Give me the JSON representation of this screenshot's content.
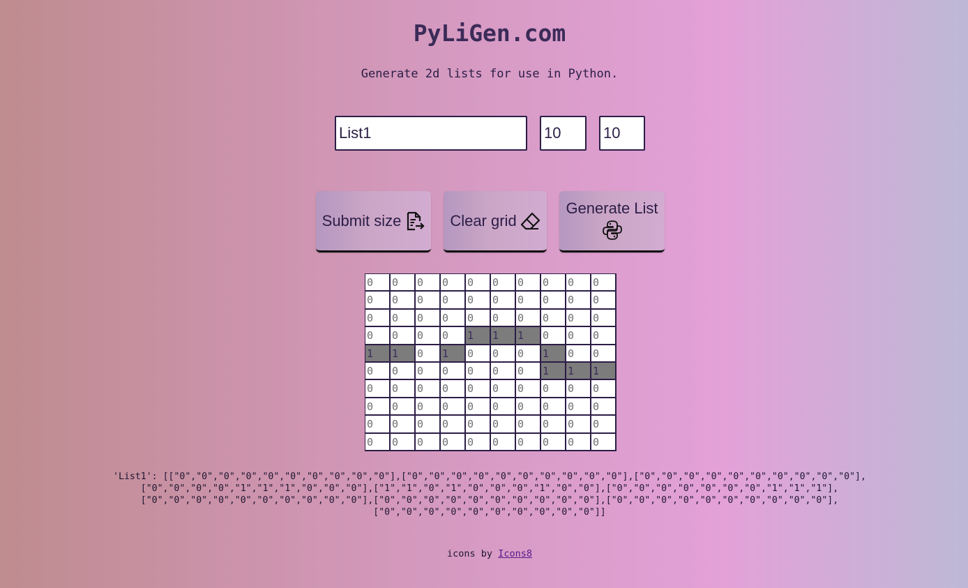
{
  "header": {
    "title": "PyLiGen.com",
    "subtitle": "Generate 2d lists for use in Python."
  },
  "form": {
    "list_name": "List1",
    "rows": "10",
    "cols": "10"
  },
  "buttons": {
    "submit_label": "Submit size",
    "clear_label": "Clear grid",
    "generate_label": "Generate List"
  },
  "grid": [
    [
      "0",
      "0",
      "0",
      "0",
      "0",
      "0",
      "0",
      "0",
      "0",
      "0"
    ],
    [
      "0",
      "0",
      "0",
      "0",
      "0",
      "0",
      "0",
      "0",
      "0",
      "0"
    ],
    [
      "0",
      "0",
      "0",
      "0",
      "0",
      "0",
      "0",
      "0",
      "0",
      "0"
    ],
    [
      "0",
      "0",
      "0",
      "0",
      "1",
      "1",
      "1",
      "0",
      "0",
      "0"
    ],
    [
      "1",
      "1",
      "0",
      "1",
      "0",
      "0",
      "0",
      "1",
      "0",
      "0"
    ],
    [
      "0",
      "0",
      "0",
      "0",
      "0",
      "0",
      "0",
      "1",
      "1",
      "1"
    ],
    [
      "0",
      "0",
      "0",
      "0",
      "0",
      "0",
      "0",
      "0",
      "0",
      "0"
    ],
    [
      "0",
      "0",
      "0",
      "0",
      "0",
      "0",
      "0",
      "0",
      "0",
      "0"
    ],
    [
      "0",
      "0",
      "0",
      "0",
      "0",
      "0",
      "0",
      "0",
      "0",
      "0"
    ],
    [
      "0",
      "0",
      "0",
      "0",
      "0",
      "0",
      "0",
      "0",
      "0",
      "0"
    ]
  ],
  "output": {
    "text": "'List1': [[\"0\",\"0\",\"0\",\"0\",\"0\",\"0\",\"0\",\"0\",\"0\",\"0\"],[\"0\",\"0\",\"0\",\"0\",\"0\",\"0\",\"0\",\"0\",\"0\",\"0\"],[\"0\",\"0\",\"0\",\"0\",\"0\",\"0\",\"0\",\"0\",\"0\",\"0\"], [\"0\",\"0\",\"0\",\"0\",\"1\",\"1\",\"1\",\"0\",\"0\",\"0\"],[\"1\",\"1\",\"0\",\"1\",\"0\",\"0\",\"0\",\"1\",\"0\",\"0\"],[\"0\",\"0\",\"0\",\"0\",\"0\",\"0\",\"0\",\"1\",\"1\",\"1\"], [\"0\",\"0\",\"0\",\"0\",\"0\",\"0\",\"0\",\"0\",\"0\",\"0\"],[\"0\",\"0\",\"0\",\"0\",\"0\",\"0\",\"0\",\"0\",\"0\",\"0\"],[\"0\",\"0\",\"0\",\"0\",\"0\",\"0\",\"0\",\"0\",\"0\",\"0\"], [\"0\",\"0\",\"0\",\"0\",\"0\",\"0\",\"0\",\"0\",\"0\",\"0\"]]"
  },
  "credit": {
    "prefix": "icons by ",
    "link": "Icons8"
  },
  "icons": {
    "submit": "document-arrow-icon",
    "clear": "eraser-icon",
    "generate": "python-icon"
  },
  "colors": {
    "active_cell": "#7c7c7c",
    "inactive_cell": "#ffffff",
    "text": "#2b1d46"
  }
}
